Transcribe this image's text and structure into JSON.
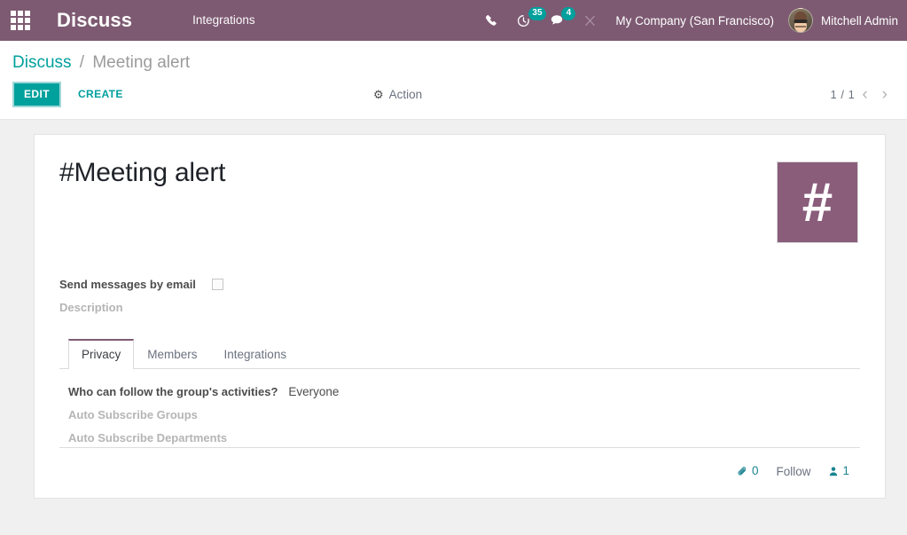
{
  "navbar": {
    "apps_icon": "apps-grid-icon",
    "brand": "Discuss",
    "menus": [
      {
        "label": "Integrations"
      }
    ],
    "systray": {
      "phone_icon": "phone-icon",
      "activity_icon": "clock-activity-icon",
      "activity_count": "35",
      "messages_icon": "messages-icon",
      "messages_count": "4",
      "tools_icon": "wrench-tools-icon",
      "company": "My Company (San Francisco)",
      "avatar_icon": "user-avatar",
      "user": "Mitchell Admin"
    },
    "colors": {
      "background": "#7d5a72",
      "badge": "#00a09d"
    }
  },
  "control_panel": {
    "breadcrumb": {
      "root": "Discuss",
      "separator": "/",
      "current": "Meeting alert"
    },
    "edit_label": "EDIT",
    "create_label": "CREATE",
    "action": {
      "icon": "gear-icon",
      "label": "Action"
    },
    "pager": {
      "value": "1 / 1",
      "previous_icon": "chevron-left-icon",
      "next_icon": "chevron-right-icon"
    },
    "colors": {
      "primary": "#00a09d"
    }
  },
  "form": {
    "title": "#Meeting alert",
    "image": {
      "icon": "hash-image",
      "glyph": "#",
      "color": "#8a5d7b"
    },
    "fields": [
      {
        "label": "Send messages by email",
        "widget": "checkbox",
        "checked": false
      },
      {
        "label": "Description",
        "widget": "placeholder-label"
      }
    ],
    "notebook": {
      "tabs": [
        {
          "label": "Privacy",
          "active": true
        },
        {
          "label": "Members",
          "active": false
        },
        {
          "label": "Integrations",
          "active": false
        }
      ],
      "privacy": {
        "privacy_label": "Who can follow the group's activities?",
        "privacy_value": "Everyone",
        "auto_subscribe_groups_label": "Auto Subscribe Groups",
        "auto_subscribe_departments_label": "Auto Subscribe Departments"
      }
    }
  },
  "chatter": {
    "attachment_icon": "paperclip-icon",
    "attachment_count": "0",
    "follow_label": "Follow",
    "followers_icon": "user-followers-icon",
    "followers_count": "1"
  }
}
